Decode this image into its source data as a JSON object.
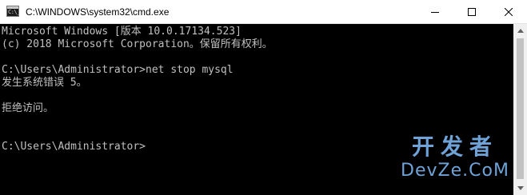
{
  "window": {
    "title": "C:\\WINDOWS\\system32\\cmd.exe",
    "icon_label": "C:\\_"
  },
  "console": {
    "lines": [
      "Microsoft Windows [版本 10.0.17134.523]",
      "(c) 2018 Microsoft Corporation。保留所有权利。",
      "",
      "C:\\Users\\Administrator>net stop mysql",
      "发生系统错误 5。",
      "",
      "拒绝访问。",
      "",
      "",
      "C:\\Users\\Administrator>"
    ]
  },
  "watermark": {
    "cn": "开发者",
    "en": "DevZe.CoM"
  },
  "colors": {
    "console_bg": "#000000",
    "console_text": "#c0c0c0",
    "titlebar_bg": "#ffffff",
    "watermark": "#6fa3d8"
  }
}
